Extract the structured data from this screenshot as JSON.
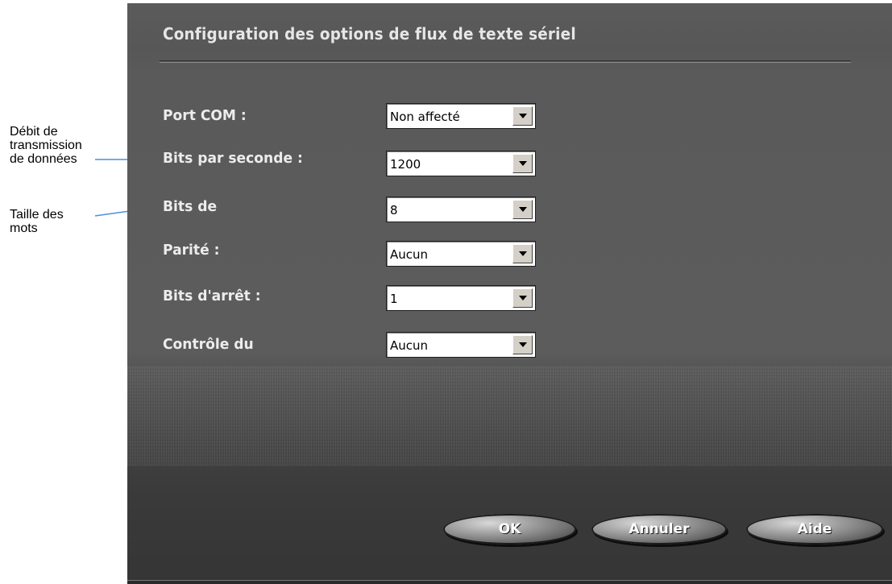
{
  "callouts": {
    "data_rate": [
      "Débit de",
      "transmission",
      "de données"
    ],
    "word_size": [
      "Taille des",
      "mots"
    ]
  },
  "dialog": {
    "title": "Configuration des options de flux de texte sériel",
    "fields": [
      {
        "label": "Port COM :",
        "value": "Non affecté"
      },
      {
        "label": "Bits par seconde :",
        "value": "1200"
      },
      {
        "label": "Bits de",
        "value": "8"
      },
      {
        "label": "Parité :",
        "value": "Aucun"
      },
      {
        "label": "Bits d'arrêt :",
        "value": "1"
      },
      {
        "label": "Contrôle du",
        "value": "Aucun"
      }
    ],
    "buttons": {
      "ok": "OK",
      "cancel": "Annuler",
      "help": "Aide"
    }
  },
  "colors": {
    "arrow": "#4a90d9",
    "panel": "#5b5b5b",
    "label_text": "#ececec"
  },
  "icons": {
    "dropdown": "chevron-down-icon"
  }
}
